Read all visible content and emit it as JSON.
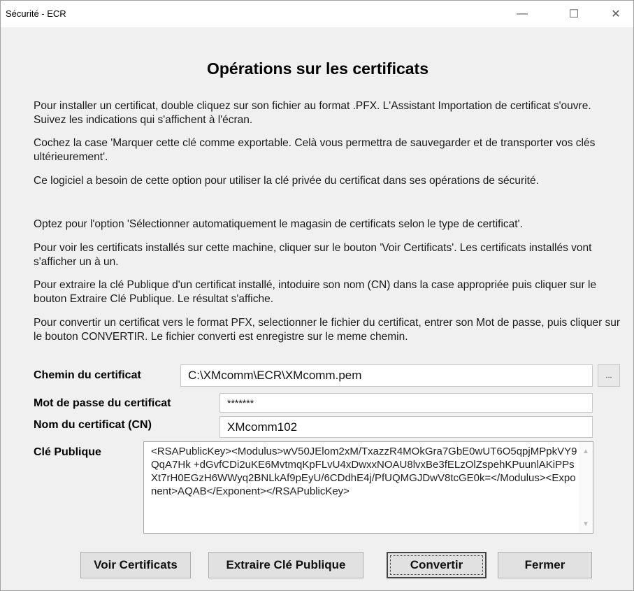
{
  "window": {
    "title": "Sécurité - ECR",
    "minimize": "—",
    "maximize": "☐",
    "close": "✕"
  },
  "heading": "Opérations sur les certificats",
  "paragraphs": [
    "Pour installer un certificat, double cliquez sur son fichier au format .PFX. L'Assistant Importation de certificat s'ouvre. Suivez les indications qui s'affichent à l'écran.",
    "Cochez la case 'Marquer cette clé comme exportable. Celà vous permettra de sauvegarder et de transporter vos clés ultérieurement'.",
    "Ce logiciel a besoin de cette option pour utiliser la clé privée du certificat dans ses opérations de sécurité.",
    "Optez pour l'option 'Sélectionner automatiquement le magasin de certificats selon le type de certificat'.",
    "Pour voir les certificats installés sur cette machine, cliquer sur le bouton 'Voir Certificats'. Les certificats installés vont s'afficher un à un.",
    "Pour extraire la clé Publique d'un certificat installé, intoduire son nom (CN) dans la case appropriée puis cliquer sur le bouton Extraire Clé Publique. Le résultat s'affiche.",
    "Pour convertir un certificat vers le format PFX, selectionner le fichier du certificat, entrer son Mot de passe, puis cliquer sur le bouton CONVERTIR. Le fichier converti est enregistre sur le meme chemin."
  ],
  "fields": {
    "path_label": "Chemin du certificat",
    "path_value": "C:\\XMcomm\\ECR\\XMcomm.pem",
    "browse_label": "...",
    "password_label": "Mot de passe du certificat",
    "password_value": "*******",
    "name_label": "Nom du certificat (CN)",
    "name_value": "XMcomm102",
    "key_label": "Clé Publique",
    "key_value": "<RSAPublicKey><Modulus>wV50JElom2xM/TxazzR4MOkGra7GbE0wUT6O5qpjMPpkVY9QqA7Hk +dGvfCDi2uKE6MvtmqKpFLvU4xDwxxNOAU8lvxBe3fELzOlZspehKPuunlAKiPPsXt7rH0EGzH6WWyq2BNLkAf9pEyU/6CDdhE4j/PfUQMGJDwV8tcGE0k=</Modulus><Exponent>AQAB</Exponent></RSAPublicKey>"
  },
  "buttons": {
    "voir": "Voir Certificats",
    "extraire": "Extraire Clé Publique",
    "convertir": "Convertir",
    "fermer": "Fermer"
  }
}
